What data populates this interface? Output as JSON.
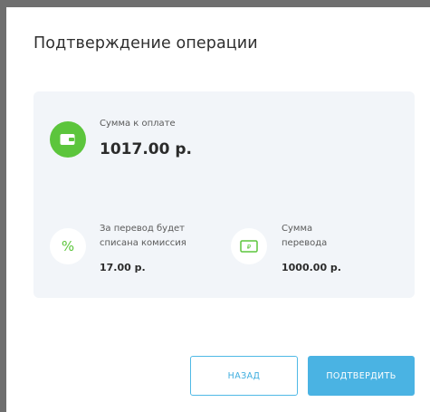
{
  "dialog": {
    "title": "Подтверждение операции"
  },
  "summary": {
    "total": {
      "label": "Сумма к оплате",
      "value": "1017.00 р.",
      "icon": "wallet-icon"
    },
    "fee": {
      "label": "За перевод будет списана комиссия",
      "value": "17.00 р.",
      "icon": "percent-icon",
      "symbol": "%"
    },
    "amount": {
      "label": "Сумма перевода",
      "value": "1000.00 р.",
      "icon": "banknote-icon"
    }
  },
  "buttons": {
    "back_label": "НАЗАД",
    "confirm_label": "ПОДТВЕРДИТЬ"
  },
  "colors": {
    "accent": "#4ab3e3",
    "success": "#5cc53c",
    "panel": "#f2f5f9"
  }
}
